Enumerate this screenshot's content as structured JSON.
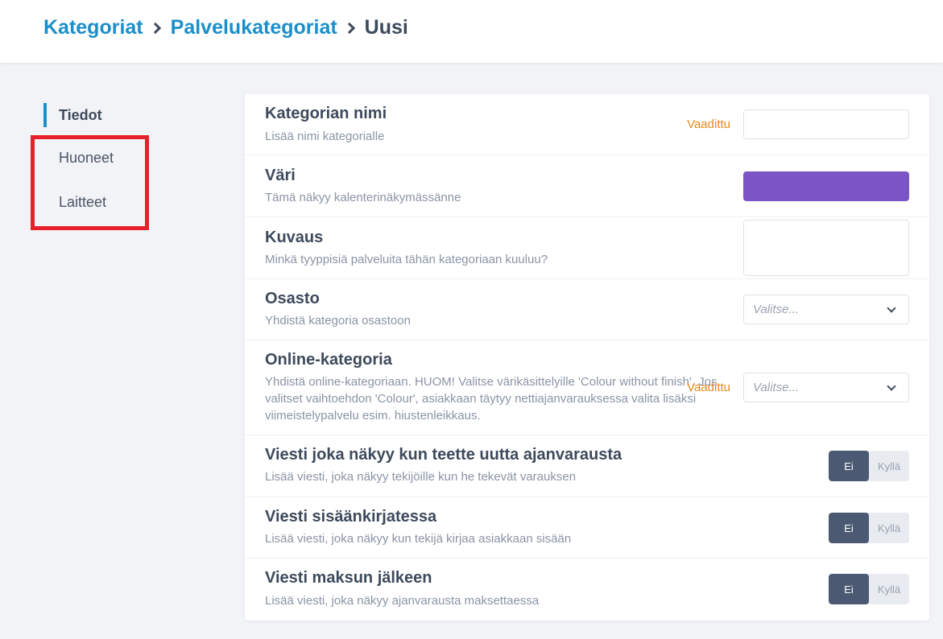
{
  "breadcrumb": {
    "items": [
      "Kategoriat",
      "Palvelukategoriat"
    ],
    "current": "Uusi"
  },
  "sidebar": {
    "items": [
      {
        "label": "Tiedot",
        "active": true
      },
      {
        "label": "Huoneet",
        "active": false
      },
      {
        "label": "Laitteet",
        "active": false
      }
    ]
  },
  "form": {
    "rows": [
      {
        "title": "Kategorian nimi",
        "description": "Lisää nimi kategorialle",
        "required": "Vaadittu",
        "value": ""
      },
      {
        "title": "Väri",
        "description": "Tämä näkyy kalenterinäkymässänne",
        "color": "#7c55c4"
      },
      {
        "title": "Kuvaus",
        "description": "Minkä tyyppisiä palveluita tähän kategoriaan kuuluu?",
        "value": ""
      },
      {
        "title": "Osasto",
        "description": "Yhdistä kategoria osastoon",
        "placeholder": "Valitse..."
      },
      {
        "title": "Online-kategoria",
        "description": "Yhdistä online-kategoriaan. HUOM! Valitse värikäsittelyille 'Colour without finish'. Jos valitset vaihtoehdon 'Colour', asiakkaan täytyy nettiajanvarauksessa valita lisäksi viimeistelypalvelu esim. hiustenleikkaus.",
        "required": "Vaadittu",
        "placeholder": "Valitse..."
      },
      {
        "title": "Viesti joka näkyy kun teette uutta ajanvarausta",
        "description": "Lisää viesti, joka näkyy tekijöille kun he tekevät varauksen",
        "off": "Ei",
        "on": "Kyllä",
        "selected": "Ei"
      },
      {
        "title": "Viesti sisäänkirjatessa",
        "description": "Lisää viesti, joka näkyy kun tekijä kirjaa asiakkaan sisään",
        "off": "Ei",
        "on": "Kyllä",
        "selected": "Ei"
      },
      {
        "title": "Viesti maksun jälkeen",
        "description": "Lisää viesti, joka näkyy ajanvarausta maksettaessa",
        "off": "Ei",
        "on": "Kyllä",
        "selected": "Ei"
      }
    ]
  },
  "colors": {
    "accent": "#1a8fc9",
    "required": "#e8891d",
    "highlight": "#e8202a",
    "toggle_active": "#4b5a72"
  }
}
